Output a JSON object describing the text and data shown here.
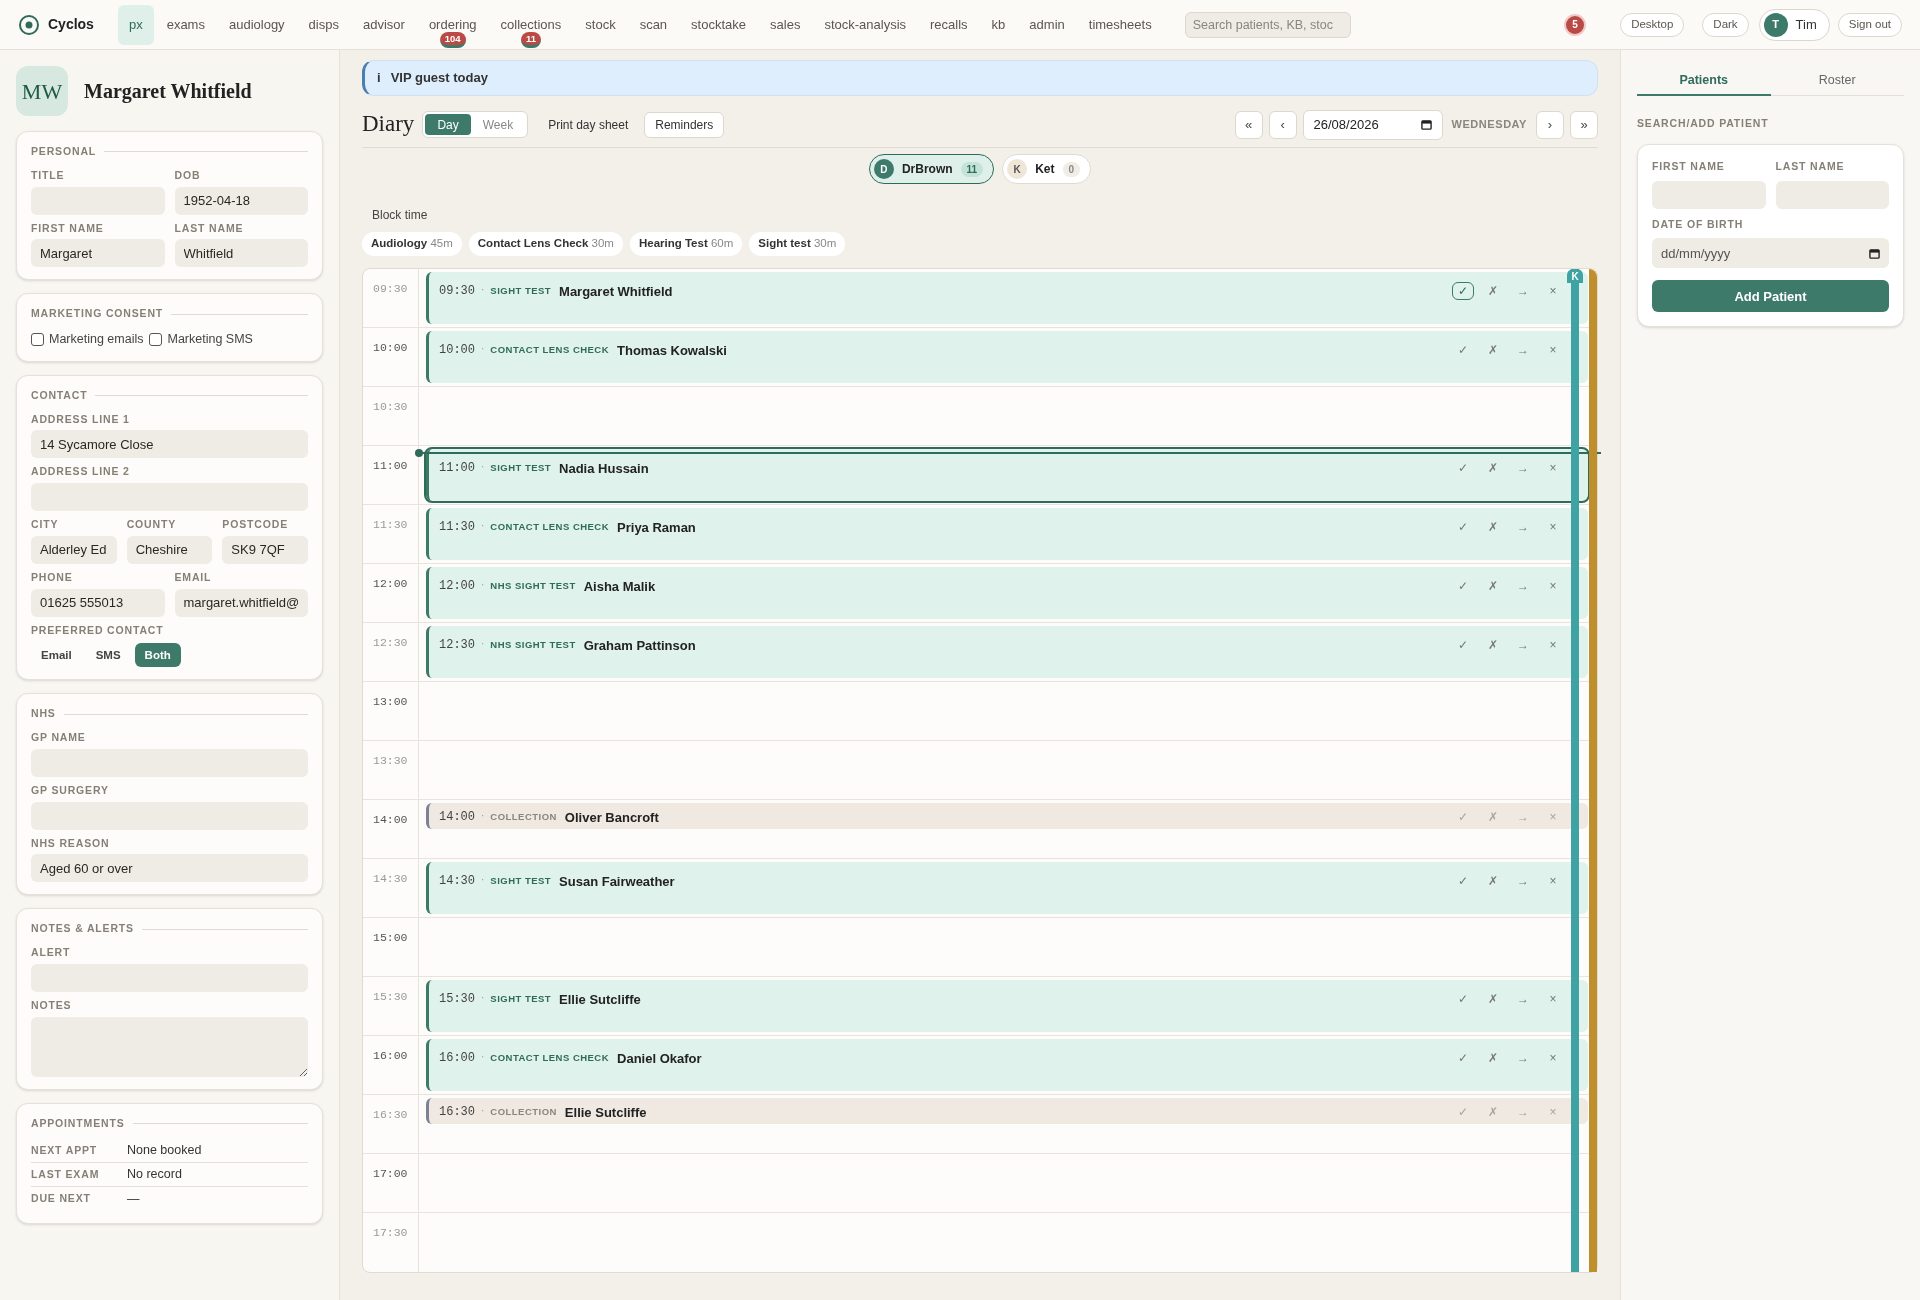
{
  "topbar": {
    "brand": "Cyclos",
    "nav": [
      {
        "label": "px",
        "selected": true
      },
      {
        "label": "exams",
        "selected": false
      },
      {
        "label": "audiology",
        "selected": false
      },
      {
        "label": "disps",
        "selected": false
      },
      {
        "label": "advisor",
        "selected": false
      },
      {
        "label": "ordering",
        "selected": false,
        "badge": "104"
      },
      {
        "label": "collections",
        "selected": false,
        "badge": "11"
      },
      {
        "label": "stock",
        "selected": false
      },
      {
        "label": "scan",
        "selected": false
      },
      {
        "label": "stocktake",
        "selected": false
      },
      {
        "label": "sales",
        "selected": false
      },
      {
        "label": "stock-analysis",
        "selected": false
      },
      {
        "label": "recalls",
        "selected": false
      },
      {
        "label": "kb",
        "selected": false
      },
      {
        "label": "admin",
        "selected": false
      },
      {
        "label": "timesheets",
        "selected": false
      }
    ],
    "search": {
      "placeholder": "Search patients, KB, stoc"
    },
    "alert_count": "5",
    "buttons": [
      "Desktop",
      "Dark"
    ],
    "user": {
      "initial": "T",
      "name": "Tim"
    },
    "sign_out": "Sign out"
  },
  "patient": {
    "initials": "MW",
    "name": "Margaret Whitfield",
    "sections": [
      {
        "title": "PERSONAL",
        "rows": [
          {
            "kind": "fields",
            "fields": [
              {
                "label": "TITLE"
              },
              {
                "label": "DOB",
                "value": "1952-04-18"
              }
            ]
          },
          {
            "kind": "fields",
            "fields": [
              {
                "label": "FIRST NAME",
                "value": "Margaret"
              },
              {
                "label": "LAST NAME",
                "value": "Whitfield"
              }
            ]
          }
        ]
      },
      {
        "title": "MARKETING CONSENT",
        "rows": [
          {
            "kind": "checks",
            "checks": [
              {
                "label": "Marketing emails",
                "checked": false
              },
              {
                "label": "Marketing SMS",
                "checked": false
              }
            ]
          }
        ]
      },
      {
        "title": "CONTACT",
        "rows": [
          {
            "kind": "fields",
            "fields": [
              {
                "label": "ADDRESS LINE 1",
                "value": "14 Sycamore Close"
              }
            ]
          },
          {
            "kind": "fields",
            "fields": [
              {
                "label": "ADDRESS LINE 2"
              }
            ]
          },
          {
            "kind": "fields",
            "fields": [
              {
                "label": "CITY",
                "value": "Alderley Ed"
              },
              {
                "label": "COUNTY",
                "value": "Cheshire"
              },
              {
                "label": "POSTCODE",
                "value": "SK9 7QF"
              }
            ]
          },
          {
            "kind": "fields",
            "fields": [
              {
                "label": "PHONE",
                "value": "01625 555013"
              },
              {
                "label": "EMAIL",
                "value": "margaret.whitfield@"
              }
            ]
          },
          {
            "kind": "choice",
            "label": "PREFERRED CONTACT",
            "options": [
              {
                "label": "Email",
                "selected": false
              },
              {
                "label": "SMS",
                "selected": false
              },
              {
                "label": "Both",
                "selected": true
              }
            ]
          }
        ]
      },
      {
        "title": "NHS",
        "rows": [
          {
            "kind": "fields",
            "fields": [
              {
                "label": "GP NAME"
              }
            ]
          },
          {
            "kind": "fields",
            "fields": [
              {
                "label": "GP SURGERY"
              }
            ]
          },
          {
            "kind": "fields",
            "fields": [
              {
                "label": "NHS REASON",
                "value": "Aged 60 or over"
              }
            ]
          }
        ]
      },
      {
        "title": "NOTES & ALERTS",
        "rows": [
          {
            "kind": "fields",
            "fields": [
              {
                "label": "ALERT"
              }
            ]
          },
          {
            "kind": "textarea",
            "label": "NOTES"
          }
        ]
      },
      {
        "title": "APPOINTMENTS",
        "rows": [
          {
            "kind": "summary",
            "items": [
              {
                "label": "NEXT APPT",
                "value": "None booked"
              },
              {
                "label": "LAST EXAM",
                "value": "No record"
              },
              {
                "label": "DUE NEXT",
                "value": "—"
              }
            ]
          }
        ]
      }
    ]
  },
  "diary": {
    "notice": {
      "icon": "i",
      "text": "VIP guest today"
    },
    "title": "Diary",
    "views": [
      {
        "label": "Day",
        "selected": true
      },
      {
        "label": "Week",
        "selected": false
      }
    ],
    "print": "Print day sheet",
    "reminders": "Reminders",
    "date_nav": {
      "first": "«",
      "prev": "‹",
      "date": "26/08/2026",
      "weekday": "WEDNESDAY",
      "next": "›",
      "last": "»"
    },
    "staff": [
      {
        "initial": "D",
        "name": "DrBrown",
        "count": "11",
        "selected": true
      },
      {
        "initial": "K",
        "name": "Ket",
        "count": "0",
        "selected": false
      }
    ],
    "block_time": {
      "label": "Block time",
      "items": [
        {
          "name": "Audiology",
          "duration": "45m"
        },
        {
          "name": "Contact Lens Check",
          "duration": "30m"
        },
        {
          "name": "Hearing Test",
          "duration": "60m"
        },
        {
          "name": "Sight test",
          "duration": "30m"
        }
      ]
    },
    "slots": [
      {
        "time": "09:30",
        "now": false,
        "appointment": {
          "kind": "clinical",
          "time": "09:30",
          "sep": "·",
          "type": "SIGHT TEST",
          "name": "Margaret Whitfield",
          "current": false,
          "actions": [
            {
              "label": "✓",
              "focused": true
            },
            {
              "label": "✗",
              "focused": false
            },
            {
              "label": "→",
              "focused": false
            },
            {
              "label": "×",
              "focused": false
            }
          ]
        }
      },
      {
        "time": "10:00",
        "now": false,
        "appointment": {
          "kind": "clinical",
          "time": "10:00",
          "sep": "·",
          "type": "CONTACT LENS CHECK",
          "name": "Thomas Kowalski",
          "current": false,
          "actions": [
            {
              "label": "✓",
              "focused": false
            },
            {
              "label": "✗",
              "focused": false
            },
            {
              "label": "→",
              "focused": false
            },
            {
              "label": "×",
              "focused": false
            }
          ]
        }
      },
      {
        "time": "10:30",
        "now": false
      },
      {
        "time": "11:00",
        "now": true,
        "appointment": {
          "kind": "clinical",
          "time": "11:00",
          "sep": "·",
          "type": "SIGHT TEST",
          "name": "Nadia Hussain",
          "current": true,
          "actions": [
            {
              "label": "✓",
              "focused": false
            },
            {
              "label": "✗",
              "focused": false
            },
            {
              "label": "→",
              "focused": false
            },
            {
              "label": "×",
              "focused": false
            }
          ]
        }
      },
      {
        "time": "11:30",
        "now": false,
        "appointment": {
          "kind": "clinical",
          "time": "11:30",
          "sep": "·",
          "type": "CONTACT LENS CHECK",
          "name": "Priya Raman",
          "current": false,
          "actions": [
            {
              "label": "✓",
              "focused": false
            },
            {
              "label": "✗",
              "focused": false
            },
            {
              "label": "→",
              "focused": false
            },
            {
              "label": "×",
              "focused": false
            }
          ]
        }
      },
      {
        "time": "12:00",
        "now": false,
        "appointment": {
          "kind": "clinical",
          "time": "12:00",
          "sep": "·",
          "type": "NHS SIGHT TEST",
          "name": "Aisha Malik",
          "current": false,
          "actions": [
            {
              "label": "✓",
              "focused": false
            },
            {
              "label": "✗",
              "focused": false
            },
            {
              "label": "→",
              "focused": false
            },
            {
              "label": "×",
              "focused": false
            }
          ]
        }
      },
      {
        "time": "12:30",
        "now": false,
        "appointment": {
          "kind": "clinical",
          "time": "12:30",
          "sep": "·",
          "type": "NHS SIGHT TEST",
          "name": "Graham Pattinson",
          "current": false,
          "actions": [
            {
              "label": "✓",
              "focused": false
            },
            {
              "label": "✗",
              "focused": false
            },
            {
              "label": "→",
              "focused": false
            },
            {
              "label": "×",
              "focused": false
            }
          ]
        }
      },
      {
        "time": "13:00",
        "now": false
      },
      {
        "time": "13:30",
        "now": false
      },
      {
        "time": "14:00",
        "now": false,
        "appointment": {
          "kind": "collection",
          "time": "14:00",
          "sep": "·",
          "type": "COLLECTION",
          "name": "Oliver Bancroft",
          "current": false,
          "actions": [
            {
              "label": "✓",
              "focused": false
            },
            {
              "label": "✗",
              "focused": false
            },
            {
              "label": "→",
              "focused": false
            },
            {
              "label": "×",
              "focused": false
            }
          ]
        }
      },
      {
        "time": "14:30",
        "now": false,
        "appointment": {
          "kind": "clinical",
          "time": "14:30",
          "sep": "·",
          "type": "SIGHT TEST",
          "name": "Susan Fairweather",
          "current": false,
          "actions": [
            {
              "label": "✓",
              "focused": false
            },
            {
              "label": "✗",
              "focused": false
            },
            {
              "label": "→",
              "focused": false
            },
            {
              "label": "×",
              "focused": false
            }
          ]
        }
      },
      {
        "time": "15:00",
        "now": false
      },
      {
        "time": "15:30",
        "now": false,
        "appointment": {
          "kind": "clinical",
          "time": "15:30",
          "sep": "·",
          "type": "SIGHT TEST",
          "name": "Ellie Sutcliffe",
          "current": false,
          "actions": [
            {
              "label": "✓",
              "focused": false
            },
            {
              "label": "✗",
              "focused": false
            },
            {
              "label": "→",
              "focused": false
            },
            {
              "label": "×",
              "focused": false
            }
          ]
        }
      },
      {
        "time": "16:00",
        "now": false,
        "appointment": {
          "kind": "clinical",
          "time": "16:00",
          "sep": "·",
          "type": "CONTACT LENS CHECK",
          "name": "Daniel Okafor",
          "current": false,
          "actions": [
            {
              "label": "✓",
              "focused": false
            },
            {
              "label": "✗",
              "focused": false
            },
            {
              "label": "→",
              "focused": false
            },
            {
              "label": "×",
              "focused": false
            }
          ]
        }
      },
      {
        "time": "16:30",
        "now": false,
        "appointment": {
          "kind": "collection",
          "time": "16:30",
          "sep": "·",
          "type": "COLLECTION",
          "name": "Ellie Sutcliffe",
          "current": false,
          "actions": [
            {
              "label": "✓",
              "focused": false
            },
            {
              "label": "✗",
              "focused": false
            },
            {
              "label": "→",
              "focused": false
            },
            {
              "label": "×",
              "focused": false
            }
          ]
        }
      },
      {
        "time": "17:00",
        "now": false
      },
      {
        "time": "17:30",
        "now": false
      }
    ],
    "lanes": [
      {
        "label": "K",
        "color": "#3fa3a3"
      },
      {
        "color": "#bf8f2d"
      }
    ]
  },
  "side": {
    "tabs": [
      {
        "label": "Patients",
        "selected": true
      },
      {
        "label": "Roster",
        "selected": false
      }
    ],
    "heading": "SEARCH/ADD PATIENT",
    "fields": [
      {
        "label": "FIRST NAME"
      },
      {
        "label": "LAST NAME"
      },
      {
        "label": "DATE OF BIRTH",
        "placeholder": "dd/mm/yyyy"
      }
    ],
    "button": "Add Patient"
  }
}
